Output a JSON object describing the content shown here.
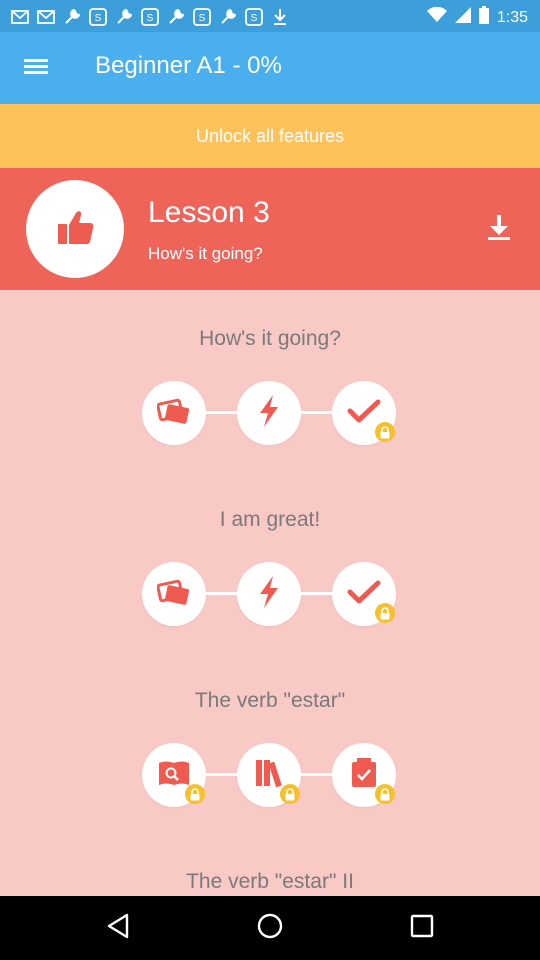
{
  "status_bar": {
    "time": "1:35",
    "left_icons": [
      "mail-icon",
      "mail-icon",
      "wrench-icon",
      "ssn-icon",
      "wrench-icon",
      "ssn-icon",
      "wrench-icon",
      "ssn-icon",
      "wrench-icon",
      "ssn-icon",
      "download-icon"
    ],
    "right_icons": [
      "wifi-icon",
      "signal-icon",
      "battery-icon"
    ]
  },
  "app_bar": {
    "title": "Beginner A1 - 0%",
    "menu_icon": "hamburger-menu-icon"
  },
  "unlock": {
    "label": "Unlock all features"
  },
  "lesson": {
    "title": "Lesson 3",
    "subtitle": "How's it going?",
    "icon": "thumbs-up-icon",
    "download_icon": "download-icon"
  },
  "sections": [
    {
      "title": "How's it going?",
      "steps": [
        {
          "icon": "cards-icon",
          "locked": false
        },
        {
          "icon": "lightning-icon",
          "locked": false
        },
        {
          "icon": "checkmark-icon",
          "locked": true
        }
      ]
    },
    {
      "title": "I am great!",
      "steps": [
        {
          "icon": "cards-icon",
          "locked": false
        },
        {
          "icon": "lightning-icon",
          "locked": false
        },
        {
          "icon": "checkmark-icon",
          "locked": true
        }
      ]
    },
    {
      "title": "The verb \"estar\"",
      "steps": [
        {
          "icon": "book-search-icon",
          "locked": true
        },
        {
          "icon": "books-icon",
          "locked": true
        },
        {
          "icon": "checklist-icon",
          "locked": true
        }
      ]
    },
    {
      "title": "The verb \"estar\" II"
    }
  ],
  "colors": {
    "status_bar": "#3d9fd9",
    "app_bar": "#4ab0ed",
    "unlock_bar": "#ffc25a",
    "lesson_card": "#ef6459",
    "background": "#f9c9c5",
    "icon_red": "#ef5b50",
    "lock_yellow": "#f6c02d"
  },
  "nav_bar": {
    "buttons": [
      "back-icon",
      "home-icon",
      "recents-icon"
    ]
  }
}
